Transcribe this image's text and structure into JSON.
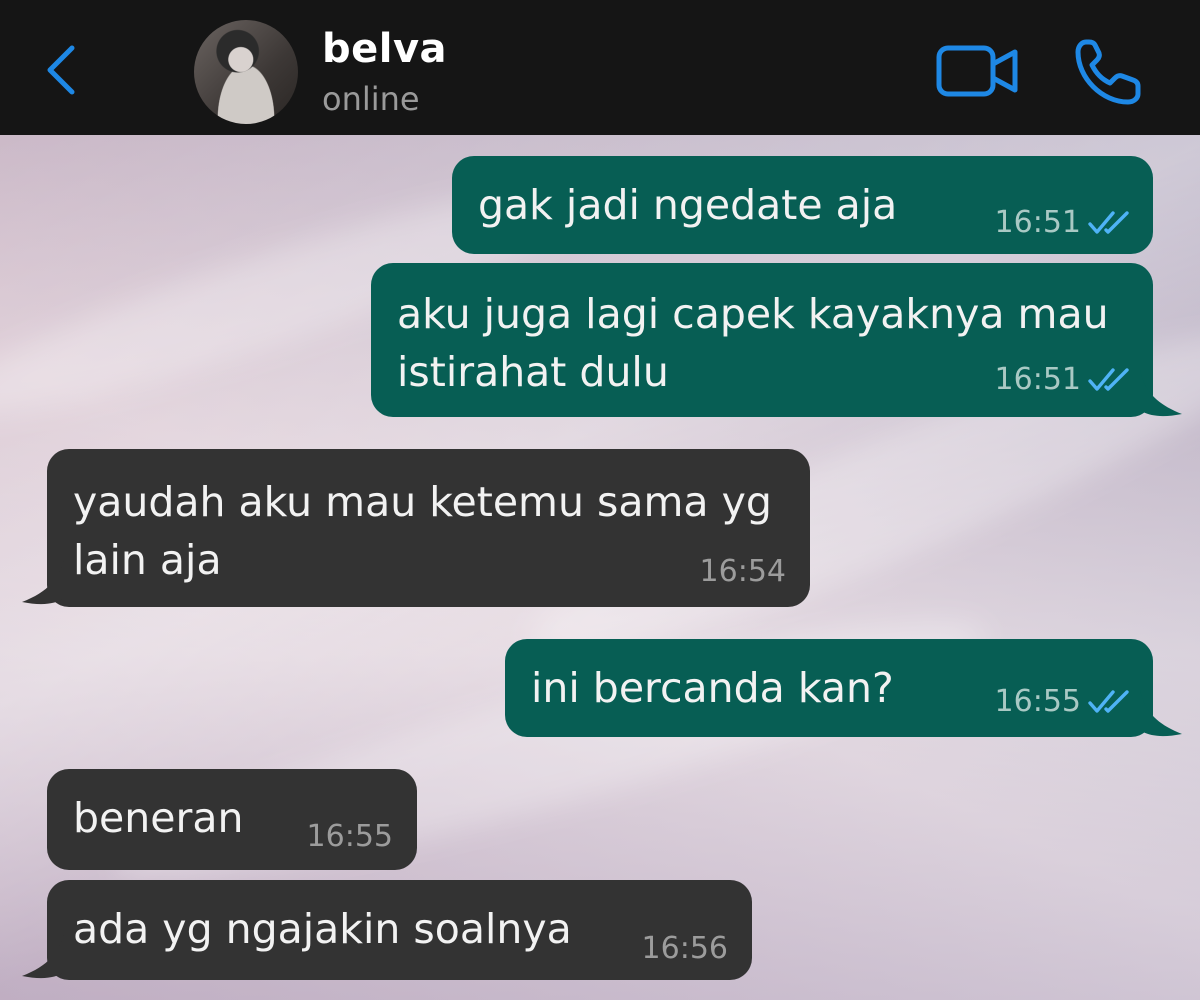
{
  "header": {
    "contact_name": "belva",
    "status": "online",
    "back_icon": "chevron-left-icon",
    "video_icon": "video-camera-icon",
    "call_icon": "phone-icon",
    "accent_color": "#1e88e5"
  },
  "messages": [
    {
      "direction": "outgoing",
      "lines": [
        "gak jadi ngedate aja"
      ],
      "time": "16:51",
      "status": "read"
    },
    {
      "direction": "outgoing",
      "lines": [
        "aku juga lagi capek kayaknya mau",
        "istirahat dulu"
      ],
      "time": "16:51",
      "status": "read"
    },
    {
      "direction": "incoming",
      "lines": [
        "yaudah aku mau ketemu sama yg",
        "lain aja"
      ],
      "time": "16:54"
    },
    {
      "direction": "outgoing",
      "lines": [
        "ini bercanda kan?"
      ],
      "time": "16:55",
      "status": "read"
    },
    {
      "direction": "incoming",
      "lines": [
        "beneran"
      ],
      "time": "16:55"
    },
    {
      "direction": "incoming",
      "lines": [
        "ada yg ngajakin soalnya"
      ],
      "time": "16:56"
    }
  ],
  "colors": {
    "outgoing_bubble": "#075e54",
    "incoming_bubble": "#333333",
    "read_ticks": "#4fb3f6",
    "header_bg": "#151515"
  }
}
